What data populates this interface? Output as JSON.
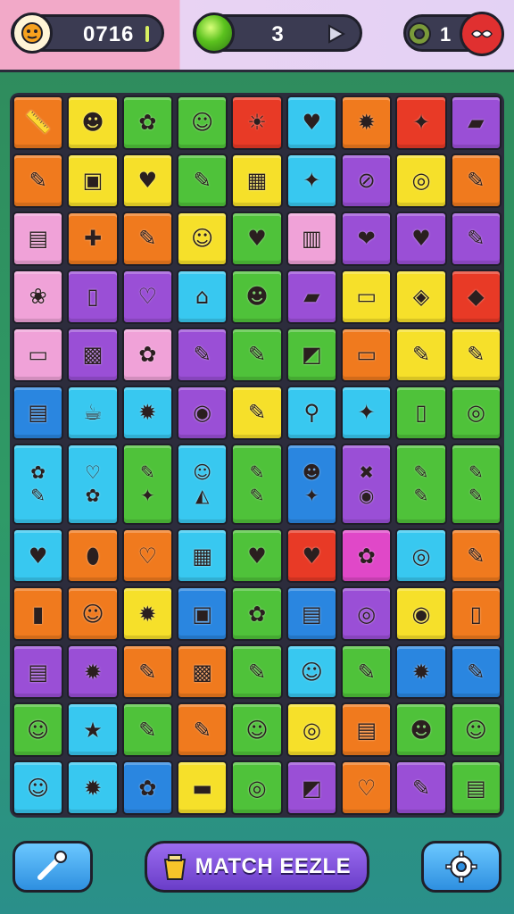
{
  "hud": {
    "score": "0716",
    "moves": "3",
    "lives": "1"
  },
  "bottom": {
    "match_label": "MATCH EEZLE"
  },
  "colors": {
    "orange": "#f07a1e",
    "yellow": "#f6e02a",
    "green": "#4fc23a",
    "red": "#e83a26",
    "cyan": "#38c8f0",
    "blue": "#2a86e0",
    "purple": "#9a4fd6",
    "pink": "#f0a2d8",
    "magenta": "#e048c8"
  },
  "board": [
    [
      {
        "c": "orange",
        "i": [
          "📏"
        ]
      },
      {
        "c": "yellow",
        "i": [
          "☻"
        ]
      },
      {
        "c": "green",
        "i": [
          "✿"
        ]
      },
      {
        "c": "green",
        "i": [
          "☺"
        ]
      },
      {
        "c": "red",
        "i": [
          "☀"
        ]
      },
      {
        "c": "cyan",
        "i": [
          "♥"
        ]
      },
      {
        "c": "orange",
        "i": [
          "✹"
        ]
      },
      {
        "c": "red",
        "i": [
          "✦"
        ]
      },
      {
        "c": "purple",
        "i": [
          "▰"
        ]
      }
    ],
    [
      {
        "c": "orange",
        "i": [
          "✎"
        ]
      },
      {
        "c": "yellow",
        "i": [
          "▣"
        ]
      },
      {
        "c": "yellow",
        "i": [
          "♥"
        ]
      },
      {
        "c": "green",
        "i": [
          "✎"
        ]
      },
      {
        "c": "yellow",
        "i": [
          "▦"
        ]
      },
      {
        "c": "cyan",
        "i": [
          "✦"
        ]
      },
      {
        "c": "purple",
        "i": [
          "⊘"
        ]
      },
      {
        "c": "yellow",
        "i": [
          "◎"
        ]
      },
      {
        "c": "orange",
        "i": [
          "✎"
        ]
      }
    ],
    [
      {
        "c": "pink",
        "i": [
          "▤"
        ]
      },
      {
        "c": "orange",
        "i": [
          "✚"
        ]
      },
      {
        "c": "orange",
        "i": [
          "✎"
        ]
      },
      {
        "c": "yellow",
        "i": [
          "☺"
        ]
      },
      {
        "c": "green",
        "i": [
          "♥"
        ]
      },
      {
        "c": "pink",
        "i": [
          "▥"
        ]
      },
      {
        "c": "purple",
        "i": [
          "❤"
        ]
      },
      {
        "c": "purple",
        "i": [
          "♥"
        ]
      },
      {
        "c": "purple",
        "i": [
          "✎"
        ]
      }
    ],
    [
      {
        "c": "pink",
        "i": [
          "❀"
        ]
      },
      {
        "c": "purple",
        "i": [
          "▯"
        ]
      },
      {
        "c": "purple",
        "i": [
          "♡"
        ]
      },
      {
        "c": "cyan",
        "i": [
          "⌂"
        ]
      },
      {
        "c": "green",
        "i": [
          "☻"
        ]
      },
      {
        "c": "purple",
        "i": [
          "▰"
        ]
      },
      {
        "c": "yellow",
        "i": [
          "▭"
        ]
      },
      {
        "c": "yellow",
        "i": [
          "◈"
        ]
      },
      {
        "c": "red",
        "i": [
          "◆"
        ]
      }
    ],
    [
      {
        "c": "pink",
        "i": [
          "▭"
        ]
      },
      {
        "c": "purple",
        "i": [
          "▩"
        ]
      },
      {
        "c": "pink",
        "i": [
          "✿"
        ]
      },
      {
        "c": "purple",
        "i": [
          "✎"
        ]
      },
      {
        "c": "green",
        "i": [
          "✎"
        ]
      },
      {
        "c": "green",
        "i": [
          "◩"
        ]
      },
      {
        "c": "orange",
        "i": [
          "▭"
        ]
      },
      {
        "c": "yellow",
        "i": [
          "✎"
        ]
      },
      {
        "c": "yellow",
        "i": [
          "✎"
        ]
      }
    ],
    [
      {
        "c": "blue",
        "i": [
          "▤"
        ]
      },
      {
        "c": "cyan",
        "i": [
          "☕"
        ]
      },
      {
        "c": "cyan",
        "i": [
          "✹"
        ]
      },
      {
        "c": "purple",
        "i": [
          "◉"
        ]
      },
      {
        "c": "yellow",
        "i": [
          "✎"
        ]
      },
      {
        "c": "cyan",
        "i": [
          "⚲"
        ]
      },
      {
        "c": "cyan",
        "i": [
          "✦"
        ]
      },
      {
        "c": "green",
        "i": [
          "▯"
        ]
      },
      {
        "c": "green",
        "i": [
          "◎"
        ]
      }
    ],
    [
      {
        "c": "cyan",
        "i": [
          "✿",
          "✎"
        ],
        "tall": true
      },
      {
        "c": "cyan",
        "i": [
          "♡",
          "✿"
        ],
        "tall": true
      },
      {
        "c": "green",
        "i": [
          "✎",
          "✦"
        ],
        "tall": true
      },
      {
        "c": "cyan",
        "i": [
          "☺",
          "◭"
        ],
        "tall": true
      },
      {
        "c": "green",
        "i": [
          "✎",
          "✎"
        ],
        "tall": true
      },
      {
        "c": "blue",
        "i": [
          "☻",
          "✦"
        ],
        "tall": true
      },
      {
        "c": "purple",
        "i": [
          "✖",
          "◉"
        ],
        "tall": true
      },
      {
        "c": "green",
        "i": [
          "✎",
          "✎"
        ],
        "tall": true
      },
      {
        "c": "green",
        "i": [
          "✎",
          "✎"
        ],
        "tall": true
      }
    ],
    [
      {
        "c": "cyan",
        "i": [
          "♥"
        ]
      },
      {
        "c": "orange",
        "i": [
          "⬮"
        ]
      },
      {
        "c": "orange",
        "i": [
          "♡"
        ]
      },
      {
        "c": "cyan",
        "i": [
          "▦"
        ]
      },
      {
        "c": "green",
        "i": [
          "♥"
        ]
      },
      {
        "c": "red",
        "i": [
          "♥"
        ]
      },
      {
        "c": "magenta",
        "i": [
          "✿"
        ]
      },
      {
        "c": "cyan",
        "i": [
          "◎"
        ]
      },
      {
        "c": "orange",
        "i": [
          "✎"
        ]
      }
    ],
    [
      {
        "c": "orange",
        "i": [
          "▮"
        ]
      },
      {
        "c": "orange",
        "i": [
          "☺"
        ]
      },
      {
        "c": "yellow",
        "i": [
          "✹"
        ]
      },
      {
        "c": "blue",
        "i": [
          "▣"
        ]
      },
      {
        "c": "green",
        "i": [
          "✿"
        ]
      },
      {
        "c": "blue",
        "i": [
          "▤"
        ]
      },
      {
        "c": "purple",
        "i": [
          "◎"
        ]
      },
      {
        "c": "yellow",
        "i": [
          "◉"
        ]
      },
      {
        "c": "orange",
        "i": [
          "▯"
        ]
      }
    ],
    [
      {
        "c": "purple",
        "i": [
          "▤"
        ]
      },
      {
        "c": "purple",
        "i": [
          "✹"
        ]
      },
      {
        "c": "orange",
        "i": [
          "✎"
        ]
      },
      {
        "c": "orange",
        "i": [
          "▩"
        ]
      },
      {
        "c": "green",
        "i": [
          "✎"
        ]
      },
      {
        "c": "cyan",
        "i": [
          "☺"
        ]
      },
      {
        "c": "green",
        "i": [
          "✎"
        ]
      },
      {
        "c": "blue",
        "i": [
          "✹"
        ]
      },
      {
        "c": "blue",
        "i": [
          "✎"
        ]
      }
    ],
    [
      {
        "c": "green",
        "i": [
          "☺"
        ]
      },
      {
        "c": "cyan",
        "i": [
          "★"
        ]
      },
      {
        "c": "green",
        "i": [
          "✎"
        ]
      },
      {
        "c": "orange",
        "i": [
          "✎"
        ]
      },
      {
        "c": "green",
        "i": [
          "☺"
        ]
      },
      {
        "c": "yellow",
        "i": [
          "◎"
        ]
      },
      {
        "c": "orange",
        "i": [
          "▤"
        ]
      },
      {
        "c": "green",
        "i": [
          "☻"
        ]
      },
      {
        "c": "green",
        "i": [
          "☺"
        ]
      }
    ],
    [
      {
        "c": "cyan",
        "i": [
          "☺"
        ]
      },
      {
        "c": "cyan",
        "i": [
          "✹"
        ]
      },
      {
        "c": "blue",
        "i": [
          "✿"
        ]
      },
      {
        "c": "yellow",
        "i": [
          "▬"
        ]
      },
      {
        "c": "green",
        "i": [
          "◎"
        ]
      },
      {
        "c": "purple",
        "i": [
          "◩"
        ]
      },
      {
        "c": "orange",
        "i": [
          "♡"
        ]
      },
      {
        "c": "purple",
        "i": [
          "✎"
        ]
      },
      {
        "c": "green",
        "i": [
          "▤"
        ]
      }
    ]
  ]
}
